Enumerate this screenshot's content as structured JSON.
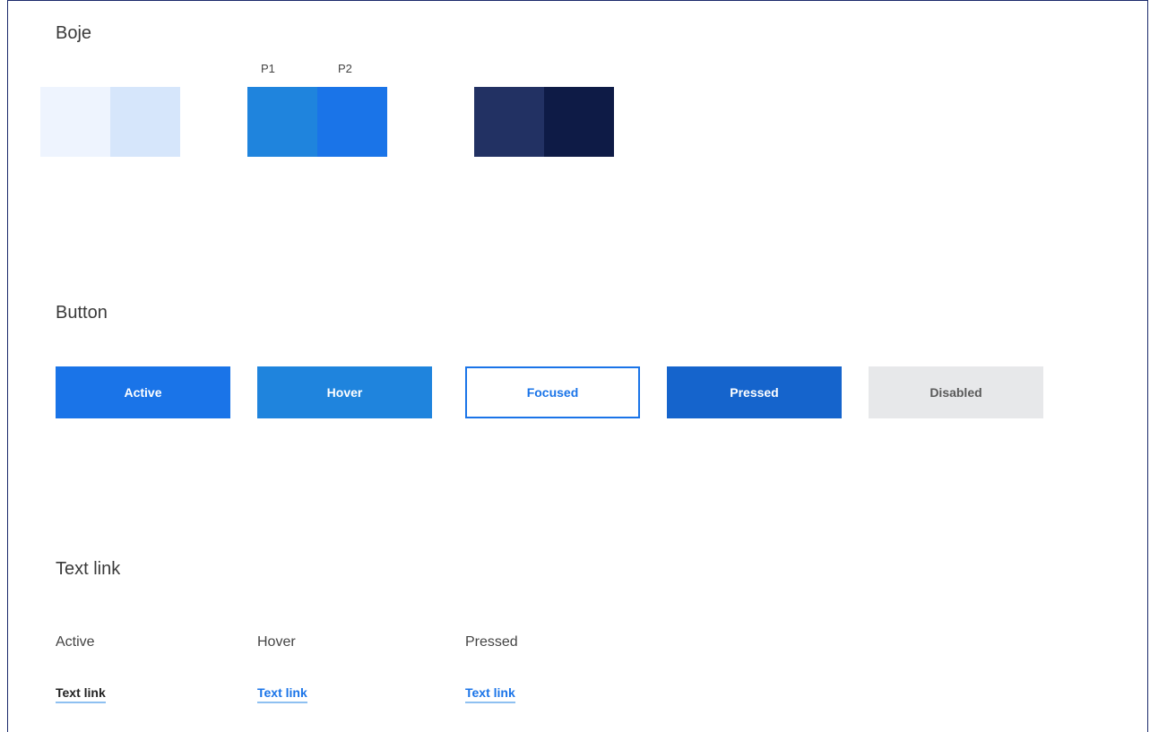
{
  "colors_section": {
    "title": "Boje",
    "swatch_labels": [
      "P1",
      "P2"
    ],
    "swatches": [
      "#eef4fe",
      "#d6e6fb",
      "#1f84dd",
      "#1a74e8",
      "#223163",
      "#0e1b46"
    ]
  },
  "button_section": {
    "title": "Button",
    "buttons": {
      "active": {
        "label": "Active",
        "bg": "#1a74e8",
        "color": "#ffffff"
      },
      "hover": {
        "label": "Hover",
        "bg": "#1f84dd",
        "color": "#ffffff"
      },
      "focused": {
        "label": "Focused",
        "bg": "#ffffff",
        "color": "#1a74e8",
        "border": "#1a74e8"
      },
      "pressed": {
        "label": "Pressed",
        "bg": "#1564cc",
        "color": "#ffffff"
      },
      "disabled": {
        "label": "Disabled",
        "bg": "#e7e8ea",
        "color": "#5a5a5a"
      }
    }
  },
  "textlink_section": {
    "title": "Text link",
    "states": [
      "Active",
      "Hover",
      "Pressed"
    ],
    "links": [
      {
        "label": "Text link",
        "color": "#222222"
      },
      {
        "label": "Text link",
        "color": "#1a74e8"
      },
      {
        "label": "Text link",
        "color": "#1a74e8"
      }
    ],
    "underline_color": "#8ec0f1"
  }
}
